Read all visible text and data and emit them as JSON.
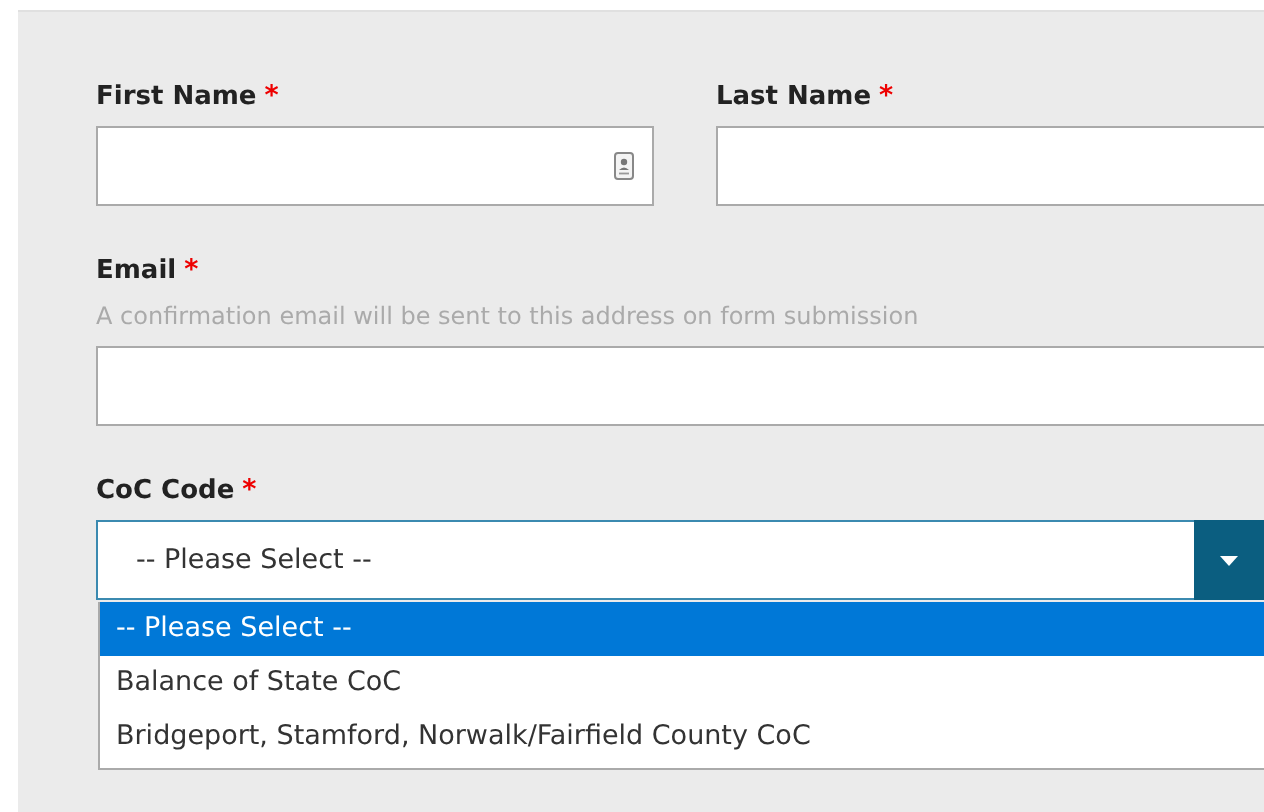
{
  "form_rows": [
    [
      {
        "kind": "text",
        "label": "First Name",
        "required_mark": "*",
        "autofill_icon": true
      },
      {
        "kind": "text",
        "label": "Last Name",
        "required_mark": "*",
        "autofill_icon": false
      }
    ],
    [
      {
        "kind": "text",
        "label": "Email",
        "required_mark": "*",
        "hint": "A confirmation email will be sent to this address on form submission",
        "autofill_icon": false
      }
    ],
    [
      {
        "kind": "select",
        "label": "CoC Code",
        "required_mark": "*",
        "value": "-- Please Select --",
        "expanded": true,
        "options": [
          {
            "label": "-- Please Select --",
            "selected": true
          },
          {
            "label": "Balance of State CoC",
            "selected": false
          },
          {
            "label": "Bridgeport, Stamford, Norwalk/Fairfield County CoC",
            "selected": false
          }
        ]
      }
    ]
  ]
}
